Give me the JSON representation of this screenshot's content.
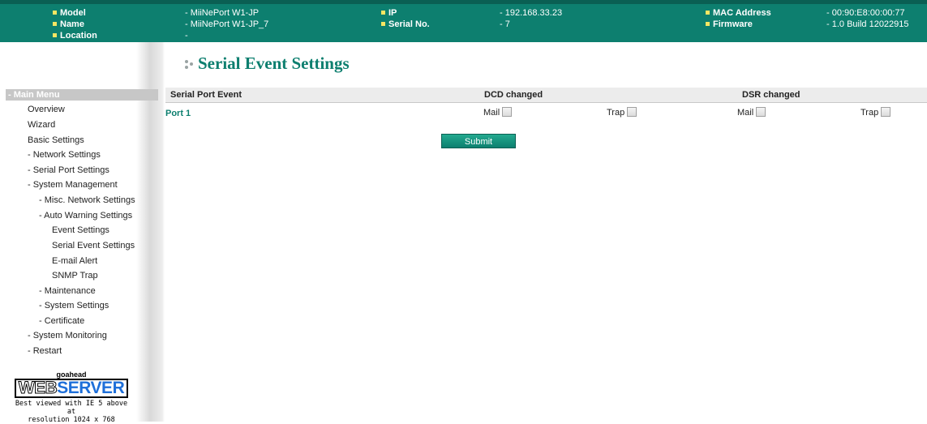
{
  "header": {
    "model_label": "Model",
    "model_value": "- MiiNePort W1-JP",
    "name_label": "Name",
    "name_value": "- MiiNePort W1-JP_7",
    "location_label": "Location",
    "location_value": "-",
    "ip_label": "IP",
    "ip_value": "- 192.168.33.23",
    "serial_label": "Serial No.",
    "serial_value": "- 7",
    "mac_label": "MAC Address",
    "mac_value": "- 00:90:E8:00:00:77",
    "firmware_label": "Firmware",
    "firmware_value": "- 1.0 Build 12022915",
    "bullet_color": "#f5e663",
    "bg_color": "#0d7f6f"
  },
  "sidebar": {
    "header": "- Main Menu",
    "items": [
      "Overview",
      "Wizard",
      "Basic Settings",
      "- Network Settings",
      "- Serial Port Settings",
      "- System Management",
      "- Misc. Network Settings",
      "- Auto Warning Settings",
      "Event Settings",
      "Serial Event Settings",
      "E-mail Alert",
      "SNMP Trap",
      "- Maintenance",
      "- System Settings",
      "- Certificate",
      "- System Monitoring",
      "- Restart"
    ],
    "logo": {
      "top": "goahead",
      "web": "WEB",
      "server": "SERVER",
      "note_line1": "Best viewed with IE 5 above at",
      "note_line2": "resolution 1024 x 768"
    }
  },
  "main": {
    "title": "Serial Event Settings",
    "columns": [
      "Serial Port Event",
      "DCD changed",
      "DSR changed"
    ],
    "port_label": "Port 1",
    "mail_label": "Mail",
    "trap_label": "Trap",
    "submit_label": "Submit"
  }
}
